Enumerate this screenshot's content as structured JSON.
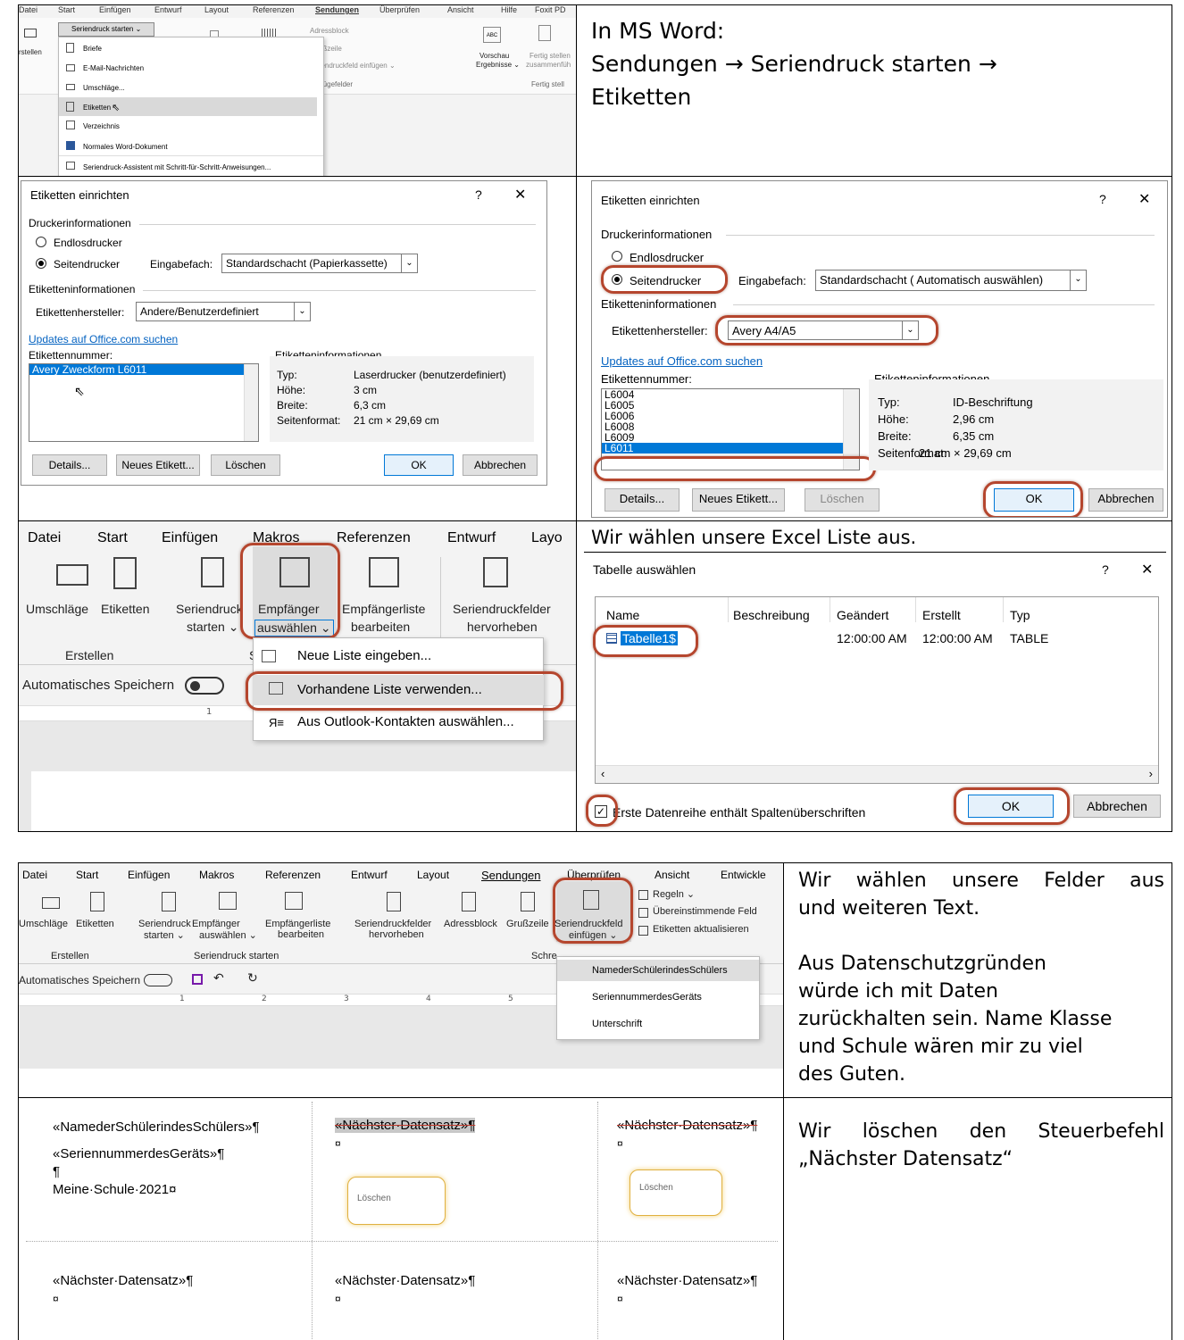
{
  "top_left_shot": {
    "menu_tabs": [
      "Datei",
      "Start",
      "Einfügen",
      "Entwurf",
      "Layout",
      "Referenzen",
      "Sendungen",
      "Überprüfen",
      "Ansicht",
      "Hilfe",
      "Foxit PD"
    ],
    "dropdown_button": "Seriendruck starten ⌄",
    "ribbon_right": {
      "adressblock": "Adressblock",
      "grusszeile": "ußzeile",
      "einfuegen": "riendruckfeld einfügen ⌄",
      "felder": "nfügefelder",
      "vorschau": "Vorschau",
      "ergebnisse": "Ergebnisse ⌄",
      "fertig1": "Fertig stellen",
      "fertig2": "zusammenfüh",
      "fertig3": "Fertig stell",
      "erstellen": "rstellen",
      "abc": "ABC"
    },
    "menu_items": [
      "Briefe",
      "E-Mail-Nachrichten",
      "Umschläge...",
      "Etiketten",
      "Verzeichnis",
      "Normales Word-Dokument",
      "Seriendruck-Assistent mit Schritt-für-Schritt-Anweisungen..."
    ]
  },
  "intro_text": [
    "In MS Word:",
    "Sendungen → Seriendruck starten →",
    "Etiketten"
  ],
  "dialog_a": {
    "title": "Etiketten einrichten",
    "q": "?",
    "x": "✕",
    "druckerinfo": "Druckerinformationen",
    "endlos": "Endlosdrucker",
    "seiten": "Seitendrucker",
    "eingabefach_label": "Eingabefach:",
    "eingabefach_value": "Standardschacht (Papierkassette)",
    "etiketteninfo": "Etiketteninformationen",
    "hersteller_label": "Etikettenhersteller:",
    "hersteller_value": "Andere/Benutzerdefiniert",
    "updates": "Updates auf Office.com suchen",
    "nummer_label": "Etikettennummer:",
    "nummer_items": [
      "Avery Zweckform L6011"
    ],
    "info_title": "Etiketteninformationen",
    "info_rows": [
      [
        "Typ:",
        "Laserdrucker (benutzerdefiniert)"
      ],
      [
        "Höhe:",
        "3 cm"
      ],
      [
        "Breite:",
        "6,3 cm"
      ],
      [
        "Seitenformat:",
        "21 cm × 29,69 cm"
      ]
    ],
    "buttons": {
      "details": "Details...",
      "neu": "Neues Etikett...",
      "loeschen": "Löschen",
      "ok": "OK",
      "abbrechen": "Abbrechen"
    }
  },
  "dialog_b": {
    "title": "Etiketten einrichten",
    "q": "?",
    "x": "✕",
    "druckerinfo": "Druckerinformationen",
    "endlos": "Endlosdrucker",
    "seiten": "Seitendrucker",
    "eingabefach_label": "Eingabefach:",
    "eingabefach_value": "Standardschacht ( Automatisch auswählen)",
    "etiketteninfo": "Etiketteninformationen",
    "hersteller_label": "Etikettenhersteller:",
    "hersteller_value": "Avery A4/A5",
    "updates": "Updates auf Office.com suchen",
    "nummer_label": "Etikettennummer:",
    "nummer_items": [
      "L6004",
      "L6005",
      "L6006",
      "L6008",
      "L6009",
      "L6011"
    ],
    "info_title": "Etiketteninformationen",
    "info_rows": [
      [
        "Typ:",
        "ID-Beschriftung"
      ],
      [
        "Höhe:",
        "2,96 cm"
      ],
      [
        "Breite:",
        "6,35 cm"
      ],
      [
        "Seitenformat:",
        "21 cm × 29,69 cm"
      ]
    ],
    "buttons": {
      "details": "Details...",
      "neu": "Neues Etikett...",
      "loeschen": "Löschen",
      "ok": "OK",
      "abbrechen": "Abbrechen"
    }
  },
  "ribbon_big": {
    "tabs": [
      "Datei",
      "Start",
      "Einfügen",
      "Makros",
      "Referenzen",
      "Entwurf",
      "Layo"
    ],
    "umschlaege": "Umschläge",
    "etiketten": "Etiketten",
    "seriendruck1": "Seriendruck",
    "seriendruck2": "starten ⌄",
    "empf1": "Empfänger",
    "empf2": "auswählen ⌄",
    "empfliste1": "Empfängerliste",
    "empfliste2": "bearbeiten",
    "felder1": "Seriendruckfelder",
    "felder2": "hervorheben",
    "erstellen": "Erstellen",
    "s": "S",
    "autosave": "Automatisches Speichern",
    "ruler": "1",
    "menu": [
      "Neue Liste eingeben...",
      "Vorhandene Liste verwenden...",
      "Aus Outlook-Kontakten auswählen..."
    ]
  },
  "excel_text": "Wir wählen unsere Excel Liste aus.",
  "dialog_table": {
    "title": "Tabelle auswählen",
    "q": "?",
    "x": "✕",
    "headers": [
      "Name",
      "Beschreibung",
      "Geändert",
      "Erstellt",
      "Typ"
    ],
    "row": [
      "Tabelle1$",
      "",
      "12:00:00 AM",
      "12:00:00 AM",
      "TABLE"
    ],
    "checkbox": "Erste Datenreihe enthält Spaltenüberschriften",
    "ok": "OK",
    "abbrechen": "Abbrechen"
  },
  "ribbon_small": {
    "tabs": [
      "Datei",
      "Start",
      "Einfügen",
      "Makros",
      "Referenzen",
      "Entwurf",
      "Layout",
      "Sendungen",
      "Überprüfen",
      "Ansicht",
      "Entwickle"
    ],
    "labels": {
      "umschlaege": "Umschläge",
      "etiketten": "Etiketten",
      "seriendruck": "Seriendruck",
      "starten": "starten ⌄",
      "empf": "Empfänger",
      "auswaehlen": "auswählen ⌄",
      "empfliste": "Empfängerliste",
      "bearbeiten": "bearbeiten",
      "felder": "Seriendruckfelder",
      "hervorheben": "hervorheben",
      "adressblock": "Adressblock",
      "gruss": "Grußzeile",
      "feld": "Seriendruckfeld",
      "einfuegen": "einfügen ⌄",
      "regeln": "Regeln ⌄",
      "uebereinst": "Übereinstimmende Feld",
      "aktualisieren": "Etiketten aktualisieren",
      "erstellen": "Erstellen",
      "starten_group": "Seriendruck starten",
      "schre": "Schre",
      "autosave": "Automatisches Speichern"
    },
    "ruler_nums": [
      "1",
      "2",
      "3",
      "4",
      "5"
    ],
    "menu": [
      "NamederSchülerindesSchülers",
      "SeriennummerdesGeräts",
      "Unterschrift"
    ]
  },
  "fields_text": [
    "Wir wählen unsere Felder aus",
    "und weiteren Text.",
    "Aus Datenschutzgründen",
    "würde ich mit Daten",
    "zurückhalten sein. Name Klasse",
    "und Schule wären mir zu viel",
    "des Guten."
  ],
  "label_doc": {
    "c1": [
      "«NamederSchülerindesSchülers»¶",
      "«SeriennummerdesGeräts»¶",
      "¶",
      "Meine·Schule·2021¤"
    ],
    "next": "«Nächster·Datensatz»¶",
    "cellmark": "¤",
    "callout": "Löschen"
  },
  "delete_text": [
    "Wir löschen den Steuerbefehl",
    "„Nächster Datensatz“"
  ]
}
